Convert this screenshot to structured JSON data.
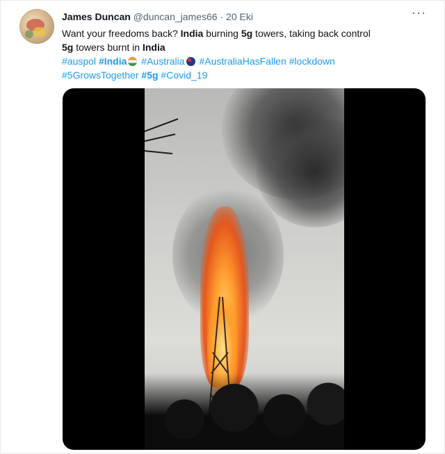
{
  "user": {
    "display_name": "James Duncan",
    "handle": "@duncan_james66",
    "separator": "·",
    "date": "20 Eki"
  },
  "more_label": "···",
  "tweet": {
    "line1_a": "Want your freedoms back? ",
    "line1_b": "India",
    "line1_c": " burning ",
    "line1_d": "5g",
    "line1_e": " towers, taking back control",
    "line2_a": "5g",
    "line2_b": " towers burnt in ",
    "line2_c": "India",
    "hashtags": {
      "auspol": "#auspol",
      "india": "#India",
      "australia": "#Australia",
      "australia_has_fallen": "#AustraliaHasFallen",
      "lockdown": "#lockdown",
      "fivegrows": "#5GrowsTogether",
      "fiveg": "#5g",
      "covid": "#Covid_19"
    },
    "emoji": {
      "india_flag": "india-flag-icon",
      "australia_flag": "australia-flag-icon"
    }
  },
  "media": {
    "type": "video",
    "subject": "burning tower"
  },
  "colors": {
    "link": "#1d9bf0",
    "text": "#0f1419",
    "muted": "#536471",
    "media_bg": "#000000"
  }
}
